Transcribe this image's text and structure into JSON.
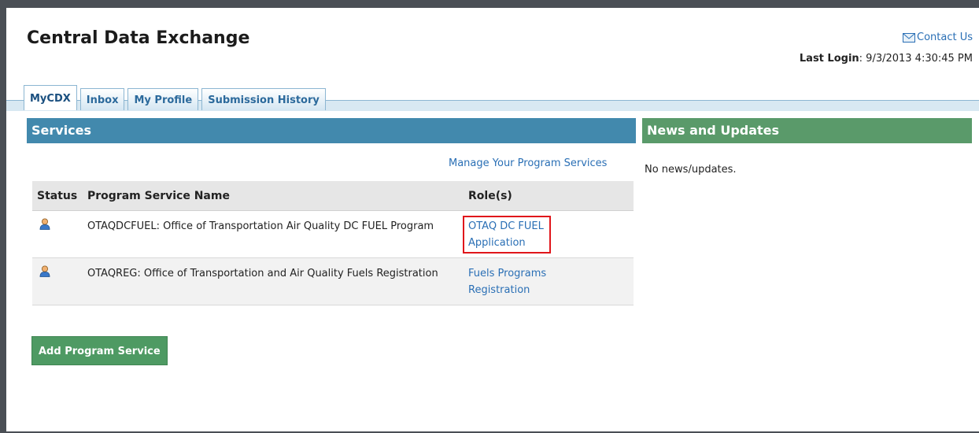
{
  "header": {
    "title": "Central Data Exchange",
    "contact_label": "Contact Us",
    "last_login_label": "Last Login",
    "last_login_value": ": 9/3/2013 4:30:45 PM"
  },
  "tabs": [
    {
      "label": "MyCDX",
      "active": true
    },
    {
      "label": "Inbox",
      "active": false
    },
    {
      "label": "My Profile",
      "active": false
    },
    {
      "label": "Submission History",
      "active": false
    }
  ],
  "services": {
    "header": "Services",
    "manage_link": "Manage Your Program Services",
    "columns": [
      "Status",
      "Program Service Name",
      "Role(s)"
    ],
    "rows": [
      {
        "name": "OTAQDCFUEL: Office of Transportation Air Quality DC FUEL Program",
        "role_line1": "OTAQ DC FUEL",
        "role_line2": "Application",
        "status_icon": "user-icon"
      },
      {
        "name": "OTAQREG: Office of Transportation and Air Quality Fuels Registration",
        "role_line1": "Fuels Programs",
        "role_line2": "Registration",
        "status_icon": "user-icon"
      }
    ],
    "add_button": "Add Program Service"
  },
  "news": {
    "header": "News and Updates",
    "text": "No news/updates."
  },
  "colors": {
    "services_header": "#4289ad",
    "news_header": "#5a9a6a",
    "link": "#2a6fb5",
    "highlight_box": "#e0161b",
    "add_button": "#4e9a63"
  }
}
